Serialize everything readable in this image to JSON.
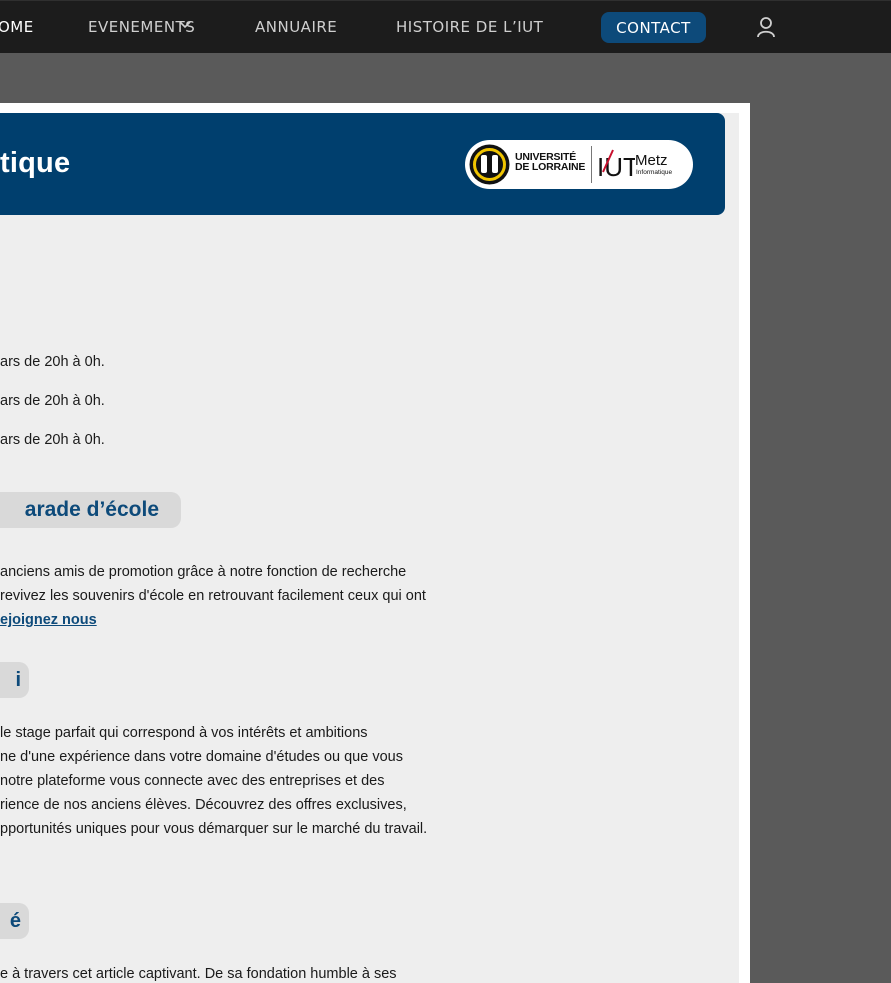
{
  "nav": {
    "home": "OME",
    "events": "EVENEMENTS",
    "annuaire": "ANNUAIRE",
    "histoire": "HISTOIRE DE L’IUT",
    "contact": "CONTACT"
  },
  "banner": {
    "title": "tique",
    "logo": {
      "univ_line1": "UNIVERSITÉ",
      "univ_line2": "DE LORRAINE",
      "iut": "IUT",
      "city": "Metz",
      "dept": "Informatique"
    }
  },
  "events": [
    "ars de 20h à 0h.",
    "ars de 20h à 0h.",
    "ars de 20h à 0h."
  ],
  "camarade": {
    "title": "arade d’école",
    "lines": [
      "anciens amis de promotion grâce à notre fonction de recherche",
      "revivez les souvenirs d'école en retrouvant facilement ceux qui ont"
    ],
    "link": "ejoignez nous"
  },
  "stage": {
    "title": "i",
    "lines": [
      "le stage parfait qui correspond à vos intérêts et ambitions",
      "ne d'une expérience dans votre domaine d'études ou que vous",
      "notre plateforme vous connecte avec des entreprises et des",
      "rience de nos anciens élèves. Découvrez des offres exclusives,",
      "pportunités uniques pour vous démarquer sur le marché du travail."
    ]
  },
  "alumni": {
    "title": "é",
    "lines": [
      "e à travers cet article captivant. De sa fondation humble à ses"
    ]
  }
}
